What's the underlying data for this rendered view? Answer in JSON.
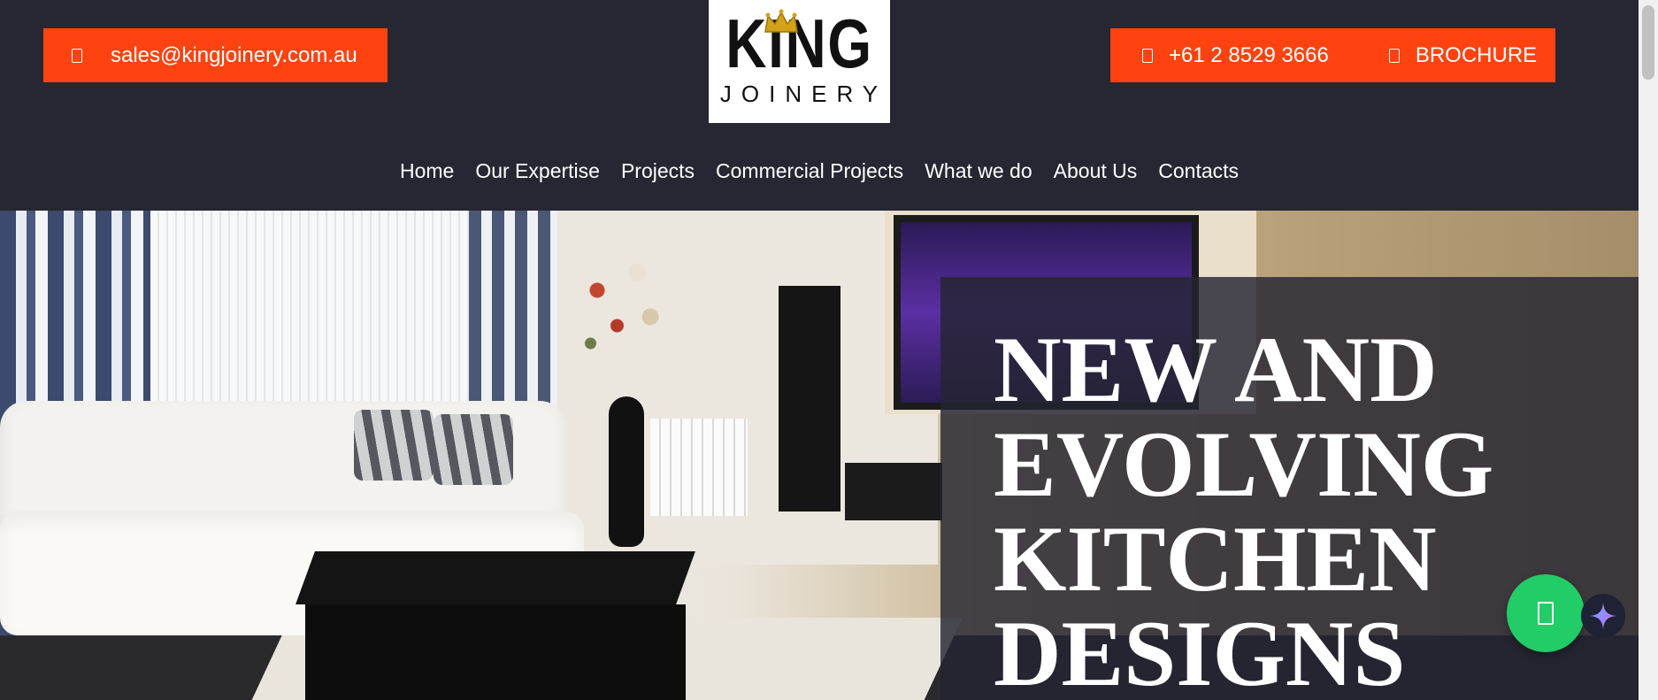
{
  "header": {
    "email": "sales@kingjoinery.com.au",
    "phone": "+61 2 8529 3666",
    "brochure": "BROCHURE",
    "logo": {
      "brand": "KING",
      "sub": "JOINERY"
    }
  },
  "nav": {
    "items": [
      "Home",
      "Our Expertise",
      "Projects",
      "Commercial Projects",
      "What we do",
      "About Us",
      "Contacts"
    ]
  },
  "hero": {
    "title_lines": [
      "NEW AND",
      "EVOLVING",
      "KITCHEN",
      "DESIGNS"
    ]
  },
  "colors": {
    "accent": "#ff4310",
    "header_bg": "#262733",
    "whatsapp": "#22cc66"
  },
  "icons": {
    "email": "envelope-icon",
    "phone": "phone-icon",
    "brochure": "document-icon",
    "chat": "whatsapp-icon",
    "ai": "sparkle-icon"
  }
}
